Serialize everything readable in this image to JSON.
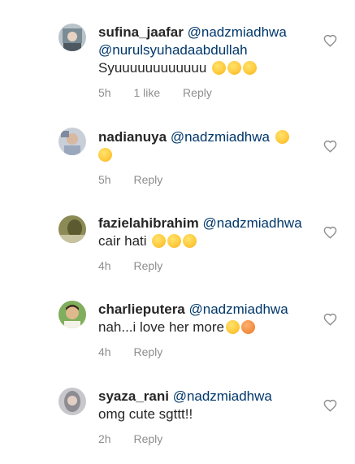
{
  "comments": [
    {
      "username": "sufina_jaafar",
      "mentions": [
        "@nadzmiadhwa",
        "@nurulsyuhadaabdullah"
      ],
      "text": "Syuuuuuuuuuuuu",
      "emojis": [
        "grinning-squint-emoji",
        "grinning-squint-emoji",
        "grinning-squint-emoji"
      ],
      "time": "5h",
      "likes": "1 like",
      "reply": "Reply",
      "avatar_color": "#7a8c96"
    },
    {
      "username": "nadianuya",
      "mentions": [
        "@nadzmiadhwa"
      ],
      "text": "",
      "emojis": [
        "heart-eyes-emoji",
        "heart-eyes-emoji"
      ],
      "time": "5h",
      "reply": "Reply",
      "avatar_color": "#9aa7bd"
    },
    {
      "username": "fazielahibrahim",
      "mentions": [
        "@nadzmiadhwa"
      ],
      "text": "cair hati",
      "emojis": [
        "heart-eyes-emoji",
        "heart-eyes-emoji",
        "heart-eyes-emoji"
      ],
      "time": "4h",
      "reply": "Reply",
      "avatar_color": "#6b6a3d"
    },
    {
      "username": "charlieputera",
      "mentions": [
        "@nadzmiadhwa"
      ],
      "text": "nah...i love her more",
      "emojis": [
        "grinning-squint-emoji",
        "cat-face-emoji"
      ],
      "time": "4h",
      "reply": "Reply",
      "avatar_color": "#5d8a4a"
    },
    {
      "username": "syaza_rani",
      "mentions": [
        "@nadzmiadhwa"
      ],
      "text": "omg cute sgttt!!",
      "emojis": [],
      "time": "2h",
      "reply": "Reply",
      "avatar_color": "#a7a6ad"
    }
  ],
  "colors": {
    "text": "#262626",
    "mention": "#00376b",
    "meta": "#8e8e8e",
    "heart_outline": "#8e8e8e"
  }
}
